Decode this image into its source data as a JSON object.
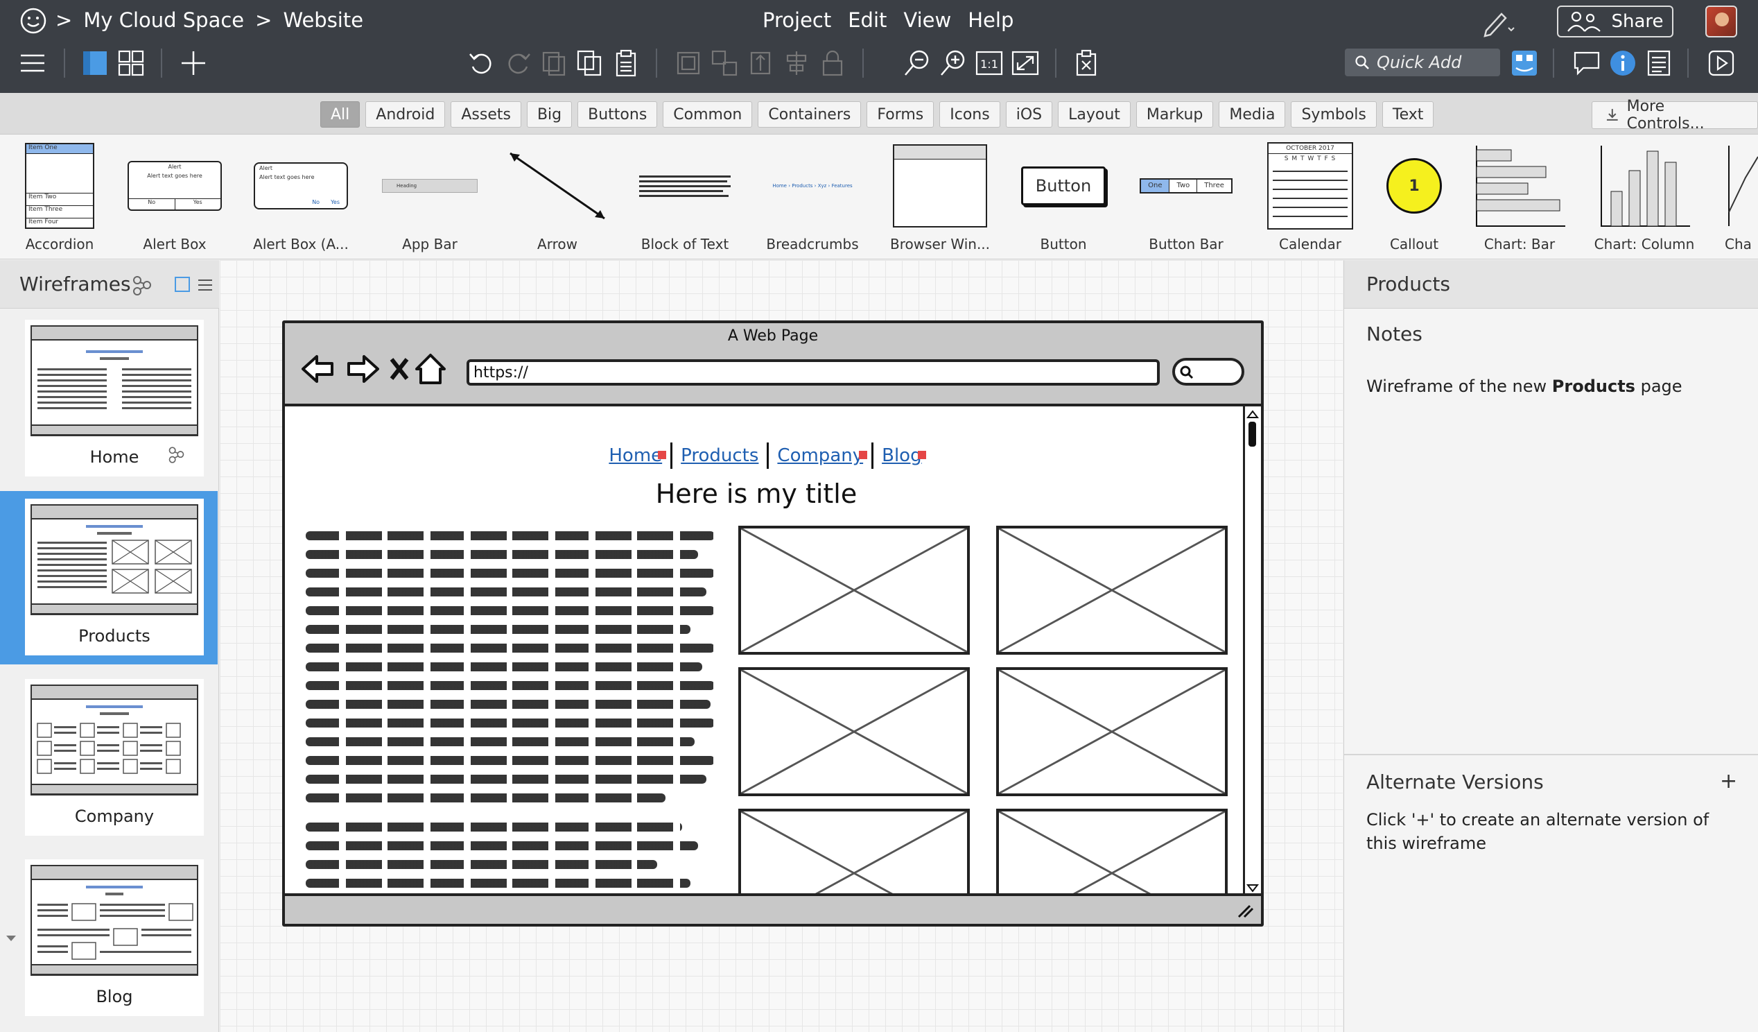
{
  "header": {
    "breadcrumb": [
      "My Cloud Space",
      "Website"
    ],
    "breadcrumb_sep": ">",
    "menu": [
      "Project",
      "Edit",
      "View",
      "Help"
    ],
    "share_label": "Share",
    "quick_add_placeholder": "Quick Add",
    "icons": [
      "smiley-icon",
      "hamburger-icon",
      "single-view-icon",
      "grid-view-icon",
      "plus-icon",
      "undo-icon",
      "redo-icon",
      "duplicate-icon",
      "copy-icon",
      "paste-icon",
      "group-icon",
      "ungroup-icon",
      "align-icon",
      "distribute-icon",
      "lock-icon",
      "zoom-out-icon",
      "zoom-in-icon",
      "actual-size-icon",
      "fit-icon",
      "delete-icon",
      "pencil-icon",
      "search-icon",
      "library-icon",
      "comment-icon",
      "info-icon",
      "list-icon",
      "play-icon"
    ],
    "accent_color": "#4b9be4"
  },
  "categories": {
    "tabs": [
      "All",
      "Android",
      "Assets",
      "Big",
      "Buttons",
      "Common",
      "Containers",
      "Forms",
      "Icons",
      "iOS",
      "Layout",
      "Markup",
      "Media",
      "Symbols",
      "Text"
    ],
    "active": "All",
    "more_label": "More Controls..."
  },
  "library": {
    "items": [
      "Accordion",
      "Alert Box",
      "Alert Box (A...",
      "App Bar",
      "Arrow",
      "Block of Text",
      "Breadcrumbs",
      "Browser Win...",
      "Button",
      "Button Bar",
      "Calendar",
      "Callout",
      "Chart: Bar",
      "Chart: Column",
      "Cha"
    ],
    "accordion_items": [
      "Item One",
      "Item Two",
      "Item Three",
      "Item Four"
    ],
    "alert_title": "Alert",
    "alert_text": "Alert text goes here",
    "alert_no": "No",
    "alert_yes": "Yes",
    "appbar_text": "Heading",
    "breadcrumbs_text": "Home › Products › Xyz › Features",
    "button_text": "Button",
    "buttonbar": [
      "One",
      "Two",
      "Three"
    ],
    "calendar_month": "OCTOBER 2017",
    "calendar_days": "S M T W T F S",
    "callout_number": "1"
  },
  "wireframes": {
    "title": "Wireframes",
    "pages": [
      "Home",
      "Products",
      "Company",
      "Blog"
    ],
    "selected": "Products"
  },
  "canvas": {
    "window_title": "A Web Page",
    "url": "https://",
    "nav_links": [
      "Home",
      "Products",
      "Company",
      "Blog"
    ],
    "heading": "Here is my title"
  },
  "right_panel": {
    "title": "Products",
    "notes_label": "Notes",
    "notes_prefix": "Wireframe of the new ",
    "notes_bold": "Products",
    "notes_suffix": " page",
    "alt_label": "Alternate Versions",
    "alt_add": "+",
    "alt_text": "Click '+' to create an alternate version of this wireframe"
  }
}
